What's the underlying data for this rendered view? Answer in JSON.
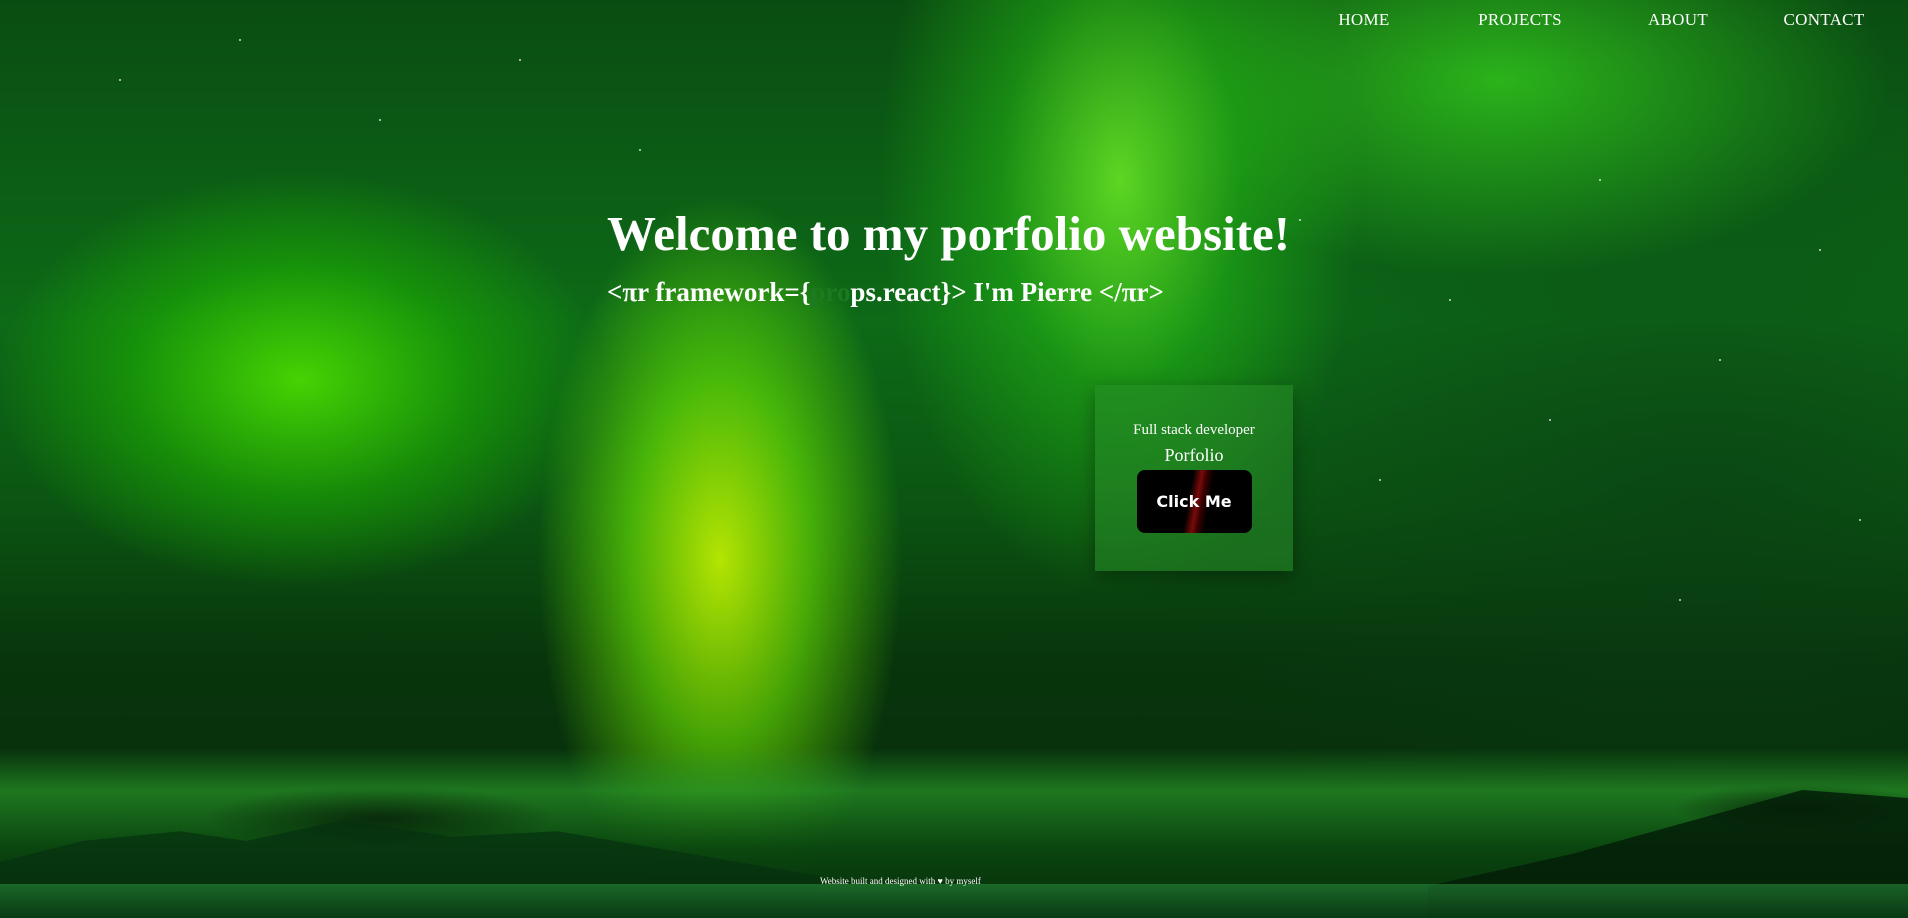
{
  "nav": {
    "items": [
      {
        "label": "HOME"
      },
      {
        "label": "PROJECTS"
      },
      {
        "label": "ABOUT"
      },
      {
        "label": "CONTACT"
      }
    ]
  },
  "hero": {
    "title": "Welcome to my porfolio website!",
    "subtitle_prefix": "<πr framework={",
    "subtitle_muted": "pro",
    "subtitle_suffix": "ps.react}> I'm Pierre </πr>"
  },
  "card": {
    "role": "Full stack developer",
    "label": "Porfolio",
    "button_label": "Click Me"
  },
  "footer": {
    "text": "Website built and designed with ♥ by myself"
  },
  "colors": {
    "accent_green": "#1c7a20",
    "text": "#ffffff",
    "button_bg": "#000000",
    "button_highlight": "#7a0a0a"
  }
}
